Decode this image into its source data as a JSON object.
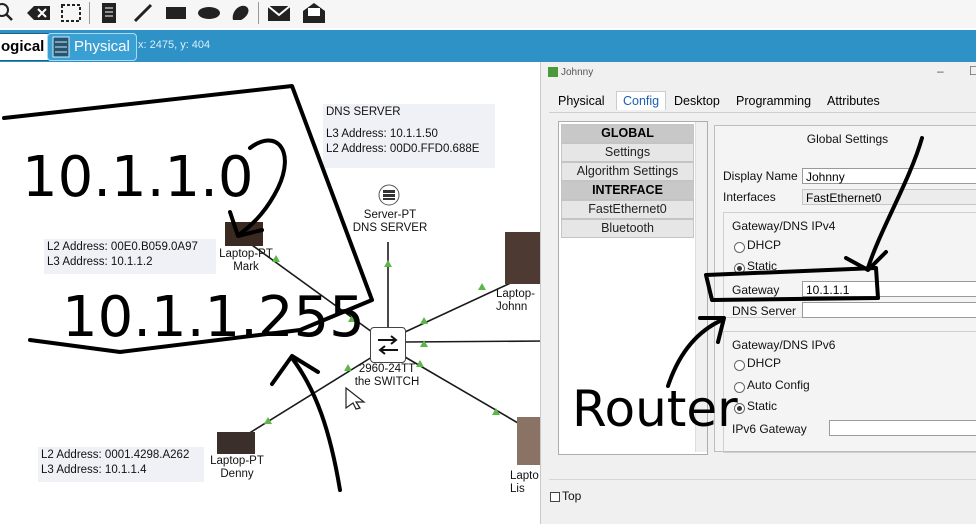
{
  "toolbar": {
    "icons": [
      "magnifier-icon",
      "delete-icon",
      "select-icon",
      "note-icon",
      "line-icon",
      "rectangle-icon",
      "ellipse-icon",
      "freeform-icon",
      "mail-icon",
      "open-envelope-icon"
    ]
  },
  "tabs": {
    "logical": "ogical",
    "physical": "Physical"
  },
  "coords": "x: 2475, y: 404",
  "canvas": {
    "dns_server_info": {
      "title": "DNS SERVER",
      "l3": "L3 Address: 10.1.1.50",
      "l2": "L2 Address: 00D0.FFD0.688E"
    },
    "mark_info": {
      "l2": "L2 Address: 00E0.B059.0A97",
      "l3": "L3 Address: 10.1.1.2"
    },
    "denny_info": {
      "l2": "L2 Address: 0001.4298.A262",
      "l3": "L3 Address: 10.1.1.4"
    },
    "server_label": {
      "line1": "Server-PT",
      "line2": "DNS SERVER"
    },
    "mark_label": {
      "line1": "Laptop-PT",
      "line2": "Mark"
    },
    "switch_label": {
      "line1": "2960-24TT",
      "line2": "the SWITCH"
    },
    "denny_label": {
      "line1": "Laptop-PT",
      "line2": "Denny"
    },
    "johnny_label": {
      "line1": "Laptop-",
      "line2": "Johnn"
    },
    "lisa_label": {
      "line1": "Lapto",
      "line2": "Lis"
    }
  },
  "annotations": {
    "network": "10.1.1.0",
    "broadcast": "10.1.1.255",
    "router": "Router"
  },
  "window": {
    "title": "Johnny",
    "controls": {
      "minimize": "–",
      "maximize": "☐"
    },
    "tabs": [
      "Physical",
      "Config",
      "Desktop",
      "Programming",
      "Attributes"
    ],
    "active_tab": "Config",
    "left_items": [
      {
        "label": "GLOBAL",
        "header": true
      },
      {
        "label": "Settings",
        "header": false
      },
      {
        "label": "Algorithm Settings",
        "header": false
      },
      {
        "label": "INTERFACE",
        "header": true
      },
      {
        "label": "FastEthernet0",
        "header": false
      },
      {
        "label": "Bluetooth",
        "header": false
      }
    ],
    "panel_title": "Global Settings",
    "display_name_label": "Display Name",
    "display_name_value": "Johnny",
    "interfaces_label": "Interfaces",
    "interfaces_value": "FastEthernet0",
    "ipv4_group": "Gateway/DNS IPv4",
    "dhcp": "DHCP",
    "static": "Static",
    "gateway_label": "Gateway",
    "gateway_value": "10.1.1.1",
    "dns_label": "DNS Server",
    "dns_value": "",
    "ipv6_group": "Gateway/DNS IPv6",
    "dhcp6": "DHCP",
    "auto_config": "Auto Config",
    "static6": "Static",
    "ipv6_gateway_label": "IPv6 Gateway",
    "ipv6_gateway_value": "",
    "top_label": "Top"
  }
}
